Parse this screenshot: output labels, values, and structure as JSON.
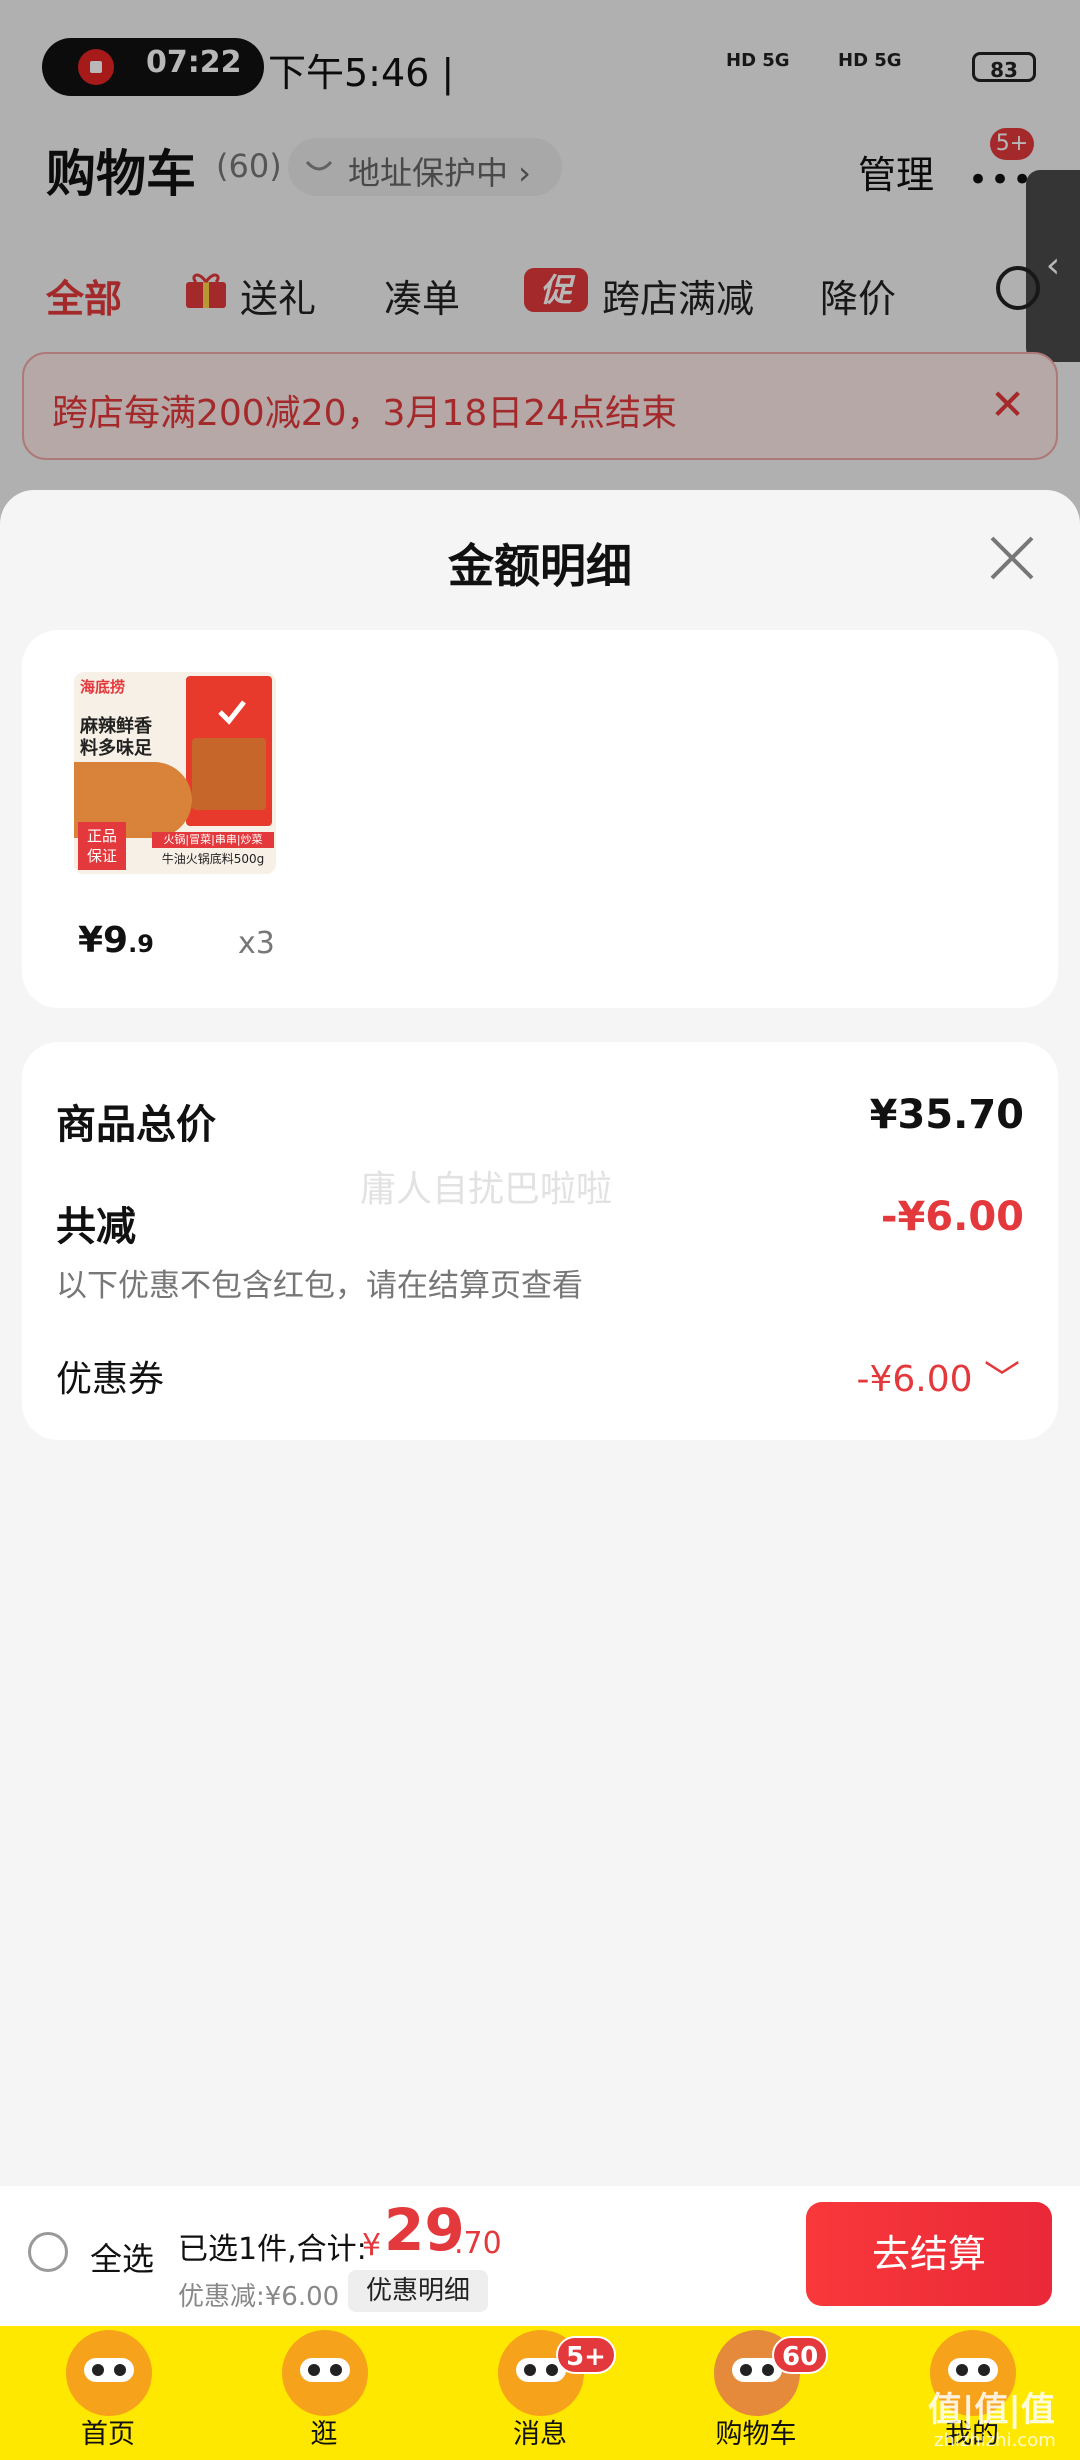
{
  "status_bar": {
    "recording_time": "07:22",
    "system_time": "下午5:46 |",
    "signal_1": "HD 5G",
    "signal_2": "HD 5G",
    "battery": "83"
  },
  "cart_header": {
    "title": "购物车",
    "count": "(60)",
    "address_protect": "地址保护中 ›",
    "manage": "管理",
    "more_badge": "5+"
  },
  "tabs": [
    "全部",
    "送礼",
    "凑单",
    "跨店满减",
    "降价"
  ],
  "promo_badge": "促",
  "promo_banner": "跨店每满200减20，3月18日24点结束",
  "sheet": {
    "title": "金额明细",
    "product": {
      "brand": "海底捞",
      "img_text_1": "麻辣鲜香",
      "img_text_2": "料多味足",
      "img_text_3": "正品",
      "img_text_4": "保证",
      "img_text_5": "火锅|冒菜|串串|炒菜",
      "img_text_6": "牛油火锅底料500g",
      "price_int": "¥9",
      "price_dec": ".9",
      "qty": "x3"
    },
    "summary": {
      "total_label": "商品总价",
      "total_value": "¥35.70",
      "reduce_label": "共减",
      "reduce_value": "-¥6.00",
      "note": "以下优惠不包含红包，请在结算页查看",
      "coupon_label": "优惠券",
      "coupon_value": "-¥6.00 ﹀"
    },
    "watermark": "庸人自扰巴啦啦"
  },
  "checkout": {
    "select_all": "全选",
    "selected": "已选1件,合计:",
    "currency": "¥",
    "total_int": "29",
    "total_dec": ".70",
    "discount": "优惠减:¥6.00",
    "detail_button": "优惠明细",
    "checkout_button": "去结算"
  },
  "nav": [
    {
      "label": "首页"
    },
    {
      "label": "逛"
    },
    {
      "label": "消息",
      "badge": "5+"
    },
    {
      "label": "购物车",
      "badge": "60"
    },
    {
      "label": "我的"
    }
  ],
  "site_watermark": {
    "main": "值|值|值",
    "sub": "zhizhizhi.com"
  },
  "colors": {
    "accent": "#e4393c",
    "nav_bg": "#ffe800"
  }
}
